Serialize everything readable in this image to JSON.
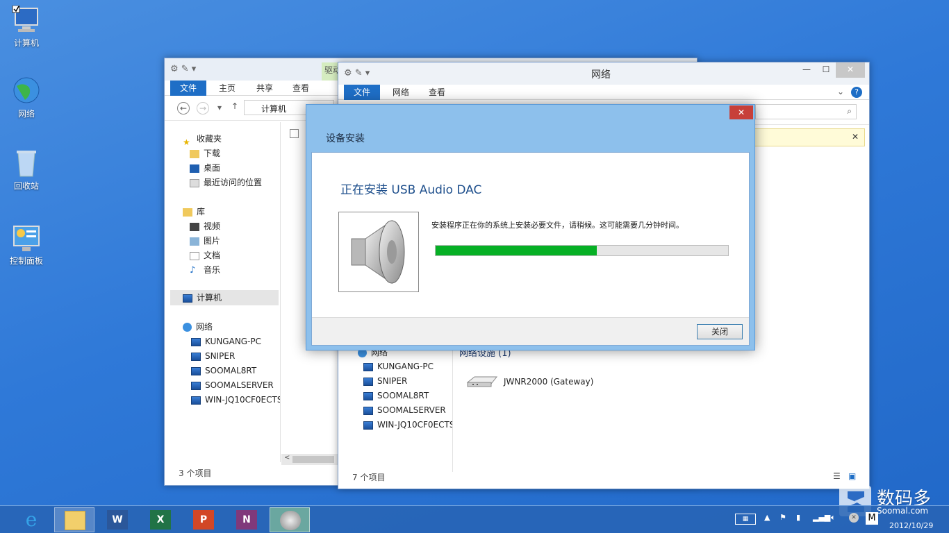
{
  "desktop": {
    "icons": [
      {
        "label": "计算机"
      },
      {
        "label": "网络"
      },
      {
        "label": "回收站"
      },
      {
        "label": "控制面板"
      }
    ]
  },
  "explorer_back": {
    "ribbon_tabs": [
      "文件",
      "主页",
      "共享",
      "查看"
    ],
    "partial_tab": "驱动",
    "address": "计算机",
    "nav": {
      "favorites": "收藏夹",
      "favorites_items": [
        "下载",
        "桌面",
        "最近访问的位置"
      ],
      "library": "库",
      "library_items": [
        "视频",
        "图片",
        "文档",
        "音乐"
      ],
      "computer": "计算机",
      "network": "网络",
      "network_items": [
        "KUNGANG-PC",
        "SNIPER",
        "SOOMAL8RT",
        "SOOMALSERVER",
        "WIN-JQ10CF0ECTS"
      ]
    },
    "status": "3 个项目"
  },
  "explorer_front": {
    "title": "网络",
    "ribbon_tabs": [
      "文件",
      "网络",
      "查看"
    ],
    "nav": {
      "network": "网络",
      "network_items": [
        "KUNGANG-PC",
        "SNIPER",
        "SOOMAL8RT",
        "SOOMALSERVER",
        "WIN-JQ10CF0ECTS"
      ]
    },
    "section_header": "网络设施 (1)",
    "device": "JWNR2000 (Gateway)",
    "status": "7 个项目"
  },
  "dialog": {
    "title": "设备安装",
    "heading": "正在安装 USB Audio DAC",
    "message": "安装程序正在你的系统上安装必要文件，请稍候。这可能需要几分钟时间。",
    "progress_fraction": 0.55,
    "close_button": "关闭"
  },
  "taskbar": {
    "apps": [
      "ie-icon",
      "file-explorer-icon",
      "word-icon",
      "excel-icon",
      "powerpoint-icon",
      "onenote-icon",
      "speaker-icon"
    ],
    "app_letters": {
      "word": "W",
      "excel": "X",
      "powerpoint": "P",
      "onenote": "N"
    },
    "date": "2012/10/29",
    "ime": "M"
  },
  "watermark": {
    "cn": "数码多",
    "en": "Soomal.com"
  },
  "colors": {
    "desktop": "#2f79d8",
    "ribbon_file": "#1e6ec6",
    "progress": "#06b025",
    "dialog_frame": "#8dc0ec"
  }
}
